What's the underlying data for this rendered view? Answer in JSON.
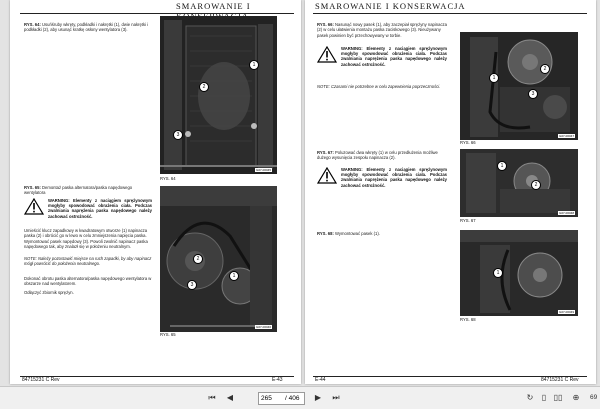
{
  "left_page": {
    "header": "SMAROWANIE I KONSERWACJA",
    "fig64_text_label": "RYS. 64:",
    "fig64_text": "Usuńśruby wkręty, podkładki i nakrętki (1), dwie nakrętki i podkładki (2), aby usunąć kratkę osłony wentylatora (3).",
    "fig65_text_label": "RYS. 65:",
    "fig65_text": "Demontaż paska alternatora/paska napędowego wentylatora",
    "warning": "WARNING: Elementy z naciągiem sprężynowym mogłyby spowodować obrażenia ciała. Podczas zwalniania naprężenia paska napędowego należy zachować ostrożność.",
    "para1": "Umieścić klucz zapadkowy w kwadratowym otworze (1) napinacza paska (2) i obrócić go w lewo w celu zmniejszenia napięcia paska. Wymontować pasek napędowy (3). Powoli zwolnić napinacz paska napędowego tak, aby znalazł się w położeniu neutralnym.",
    "note": "NOTE: Należy pozostawić miejsce na ruch zapadki, by aby napinacz mógł powrócić do położenia neutralnego.",
    "para2": "Dokonać obrotu paska alternatora/paska napędowego wentylatora w obszarze nad wentylatorem.",
    "para3": "Odłączyć zbiornik sprężyn.",
    "fig64_caption": "RYS. 64",
    "fig65_caption": "RYS. 65",
    "fig64_stamp": "G07-00045",
    "fig65_stamp": "G07-00046",
    "footer_left": "84715231 C Rev",
    "footer_right": "E-43"
  },
  "right_page": {
    "header": "SMAROWANIE I KONSERWACJA",
    "fig66_text_label": "RYS. 66:",
    "fig66_text": "Nasunąć nowy pasek (1), aby zaczepiał sprężyny napinacza (2) w celu ułatwienia montażu paska zaciskowego (3). Nieużywany pasek powinien być przechowywany w torbie.",
    "warning1": "WARNING: Elementy z naciągiem sprężynowym mogłyby spowodować obrażenia ciała. Podczas zwalniania naprężenia paska napędowego należy zachować ostrożność.",
    "note": "NOTE: Czasami nie potrzebne w celu zapewnienia poprzeczności.",
    "fig67_text_label": "RYS. 67:",
    "fig67_text": "Poluzować dwa wkręty (1) w celu przedłużenia możliwe dużego wysunięcia zespołu napinacza (2).",
    "warning2": "WARNING: Elementy z naciągiem sprężynowym mogłyby spowodować obrażenia ciała. Podczas zwalniania naprężenia paska napędowego należy zachować ostrożność.",
    "fig68_text_label": "RYS. 68:",
    "fig68_text": "Wymontować pasek (1).",
    "fig66_caption": "RYS. 66",
    "fig67_caption": "RYS. 67",
    "fig68_caption": "RYS. 68",
    "fig66_stamp": "G07-00047",
    "fig67_stamp": "G07-00048",
    "fig68_stamp": "G07-00049",
    "footer_left": "E-44",
    "footer_right": "84715231 C Rev"
  },
  "callouts": {
    "c1": "1",
    "c2": "2",
    "c3": "3"
  },
  "toolbar": {
    "current_page": "265",
    "page_separator": "/ 406",
    "zoom": "69",
    "first_icon": "first-page-icon",
    "prev_icon": "previous-page-icon",
    "next_icon": "next-page-icon",
    "last_icon": "last-page-icon"
  }
}
